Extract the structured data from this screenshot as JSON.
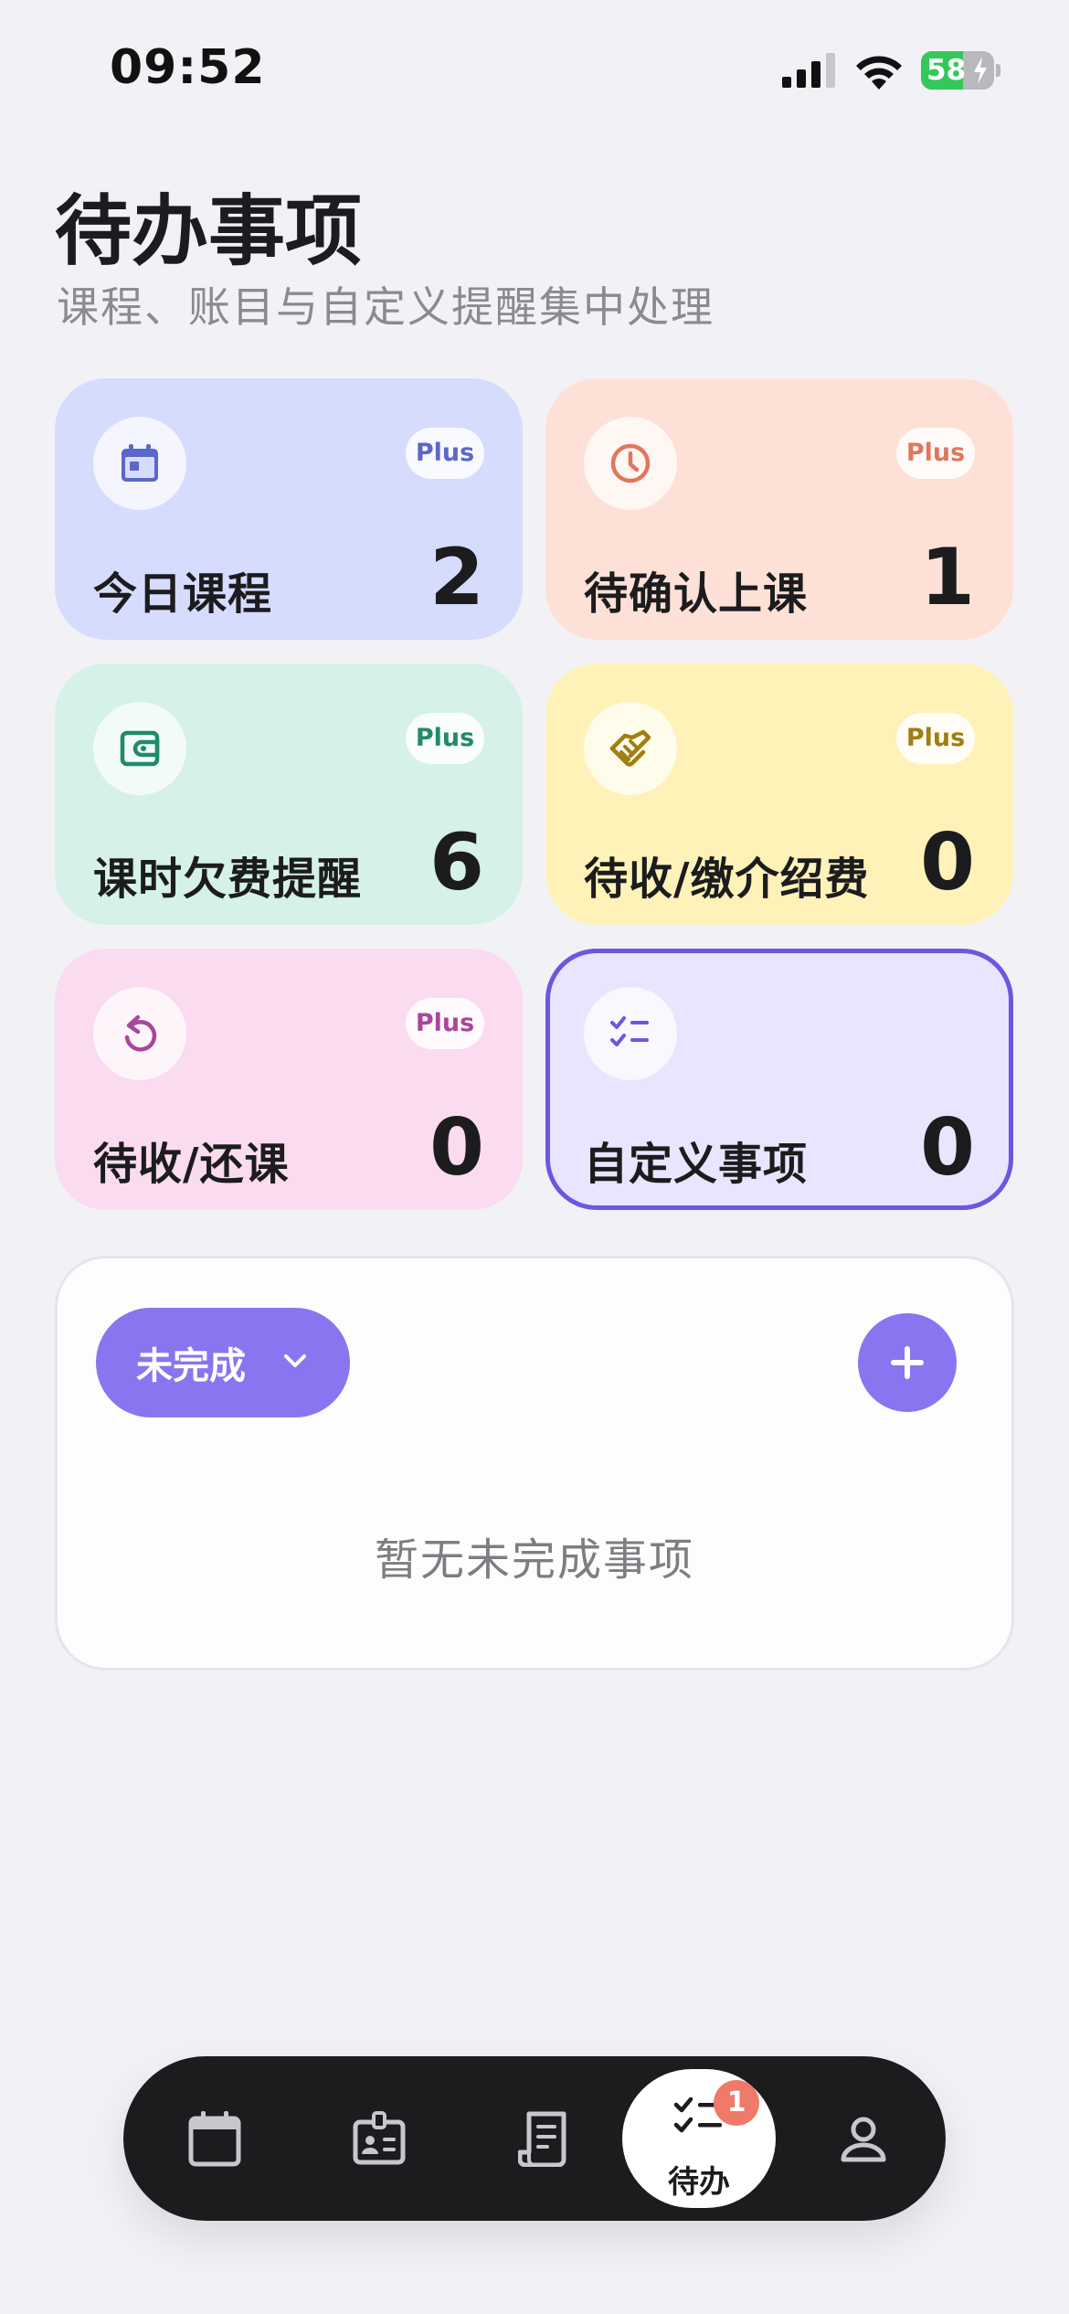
{
  "status_bar": {
    "time": "09:52",
    "battery": "58",
    "battery_level": 0.58,
    "charging": true,
    "battery_color": "#34c759"
  },
  "header": {
    "title": "待办事项",
    "subtitle": "课程、账目与自定义提醒集中处理"
  },
  "cards": [
    {
      "label": "今日课程",
      "count": "2",
      "badge": "Plus",
      "icon": "calendar-icon",
      "bg": "#d6dcfd",
      "accent": "#5b67c9"
    },
    {
      "label": "待确认上课",
      "count": "1",
      "badge": "Plus",
      "icon": "clock-icon",
      "bg": "#fde1d7",
      "accent": "#e2765f"
    },
    {
      "label": "课时欠费提醒",
      "count": "6",
      "badge": "Plus",
      "icon": "wallet-icon",
      "bg": "#d5f1e8",
      "accent": "#1f8a6c"
    },
    {
      "label": "待收/缴介绍费",
      "count": "0",
      "badge": "Plus",
      "icon": "handshake-icon",
      "bg": "#fef2b8",
      "accent": "#a17d12"
    },
    {
      "label": "待收/还课",
      "count": "0",
      "badge": "Plus",
      "icon": "undo-icon",
      "bg": "#fadbef",
      "accent": "#a9479a"
    },
    {
      "label": "自定义事项",
      "count": "0",
      "icon": "checklist-icon",
      "bg": "#e8e6fe",
      "accent": "#6b57e0",
      "selected": true
    }
  ],
  "list": {
    "filter_label": "未完成",
    "empty_text": "暂无未完成事项",
    "accent": "#8b74f0"
  },
  "tab_bar": {
    "items": [
      {
        "icon": "calendar-icon"
      },
      {
        "icon": "id-card-icon"
      },
      {
        "icon": "receipt-icon"
      },
      {
        "icon": "checklist-icon",
        "label": "待办",
        "badge": "1",
        "active": true
      },
      {
        "icon": "person-icon"
      }
    ]
  }
}
